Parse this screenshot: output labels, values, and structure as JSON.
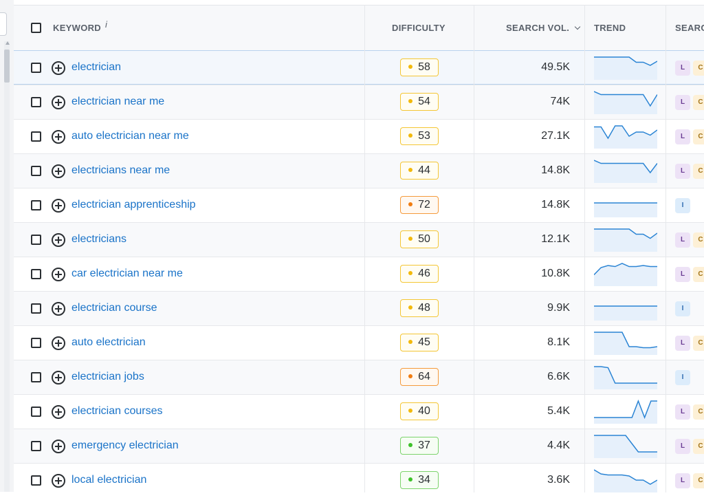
{
  "headers": {
    "keyword": "KEYWORD",
    "keyword_info": "i",
    "difficulty": "DIFFICULTY",
    "search_volume": "SEARCH VOL.",
    "trend": "TREND",
    "intent": "SEARC"
  },
  "colors": {
    "link": "#1a73c8",
    "kd_yellow": "#f2b90c",
    "kd_orange": "#f07d12",
    "kd_green": "#3ec12a",
    "trend_line": "#2a84d4",
    "trend_fill": "#e6f0fb"
  },
  "rows": [
    {
      "keyword": "electrician",
      "kd": "58",
      "kd_level": "yellow",
      "volume": "49.5K",
      "intents": [
        "L",
        "C"
      ],
      "trend": [
        1,
        1,
        1,
        1,
        1,
        1,
        0.75,
        0.75,
        0.6,
        0.8
      ],
      "selected": true
    },
    {
      "keyword": "electrician near me",
      "kd": "54",
      "kd_level": "yellow",
      "volume": "74K",
      "intents": [
        "L",
        "C"
      ],
      "trend": [
        1,
        0.85,
        0.85,
        0.85,
        0.85,
        0.85,
        0.85,
        0.85,
        0.3,
        0.85
      ]
    },
    {
      "keyword": "auto electrician near me",
      "kd": "53",
      "kd_level": "yellow",
      "volume": "27.1K",
      "intents": [
        "L",
        "C"
      ],
      "trend": [
        0.95,
        0.95,
        0.4,
        1,
        1,
        0.5,
        0.7,
        0.7,
        0.55,
        0.8
      ]
    },
    {
      "keyword": "electricians near me",
      "kd": "44",
      "kd_level": "yellow",
      "volume": "14.8K",
      "intents": [
        "L",
        "C"
      ],
      "trend": [
        1,
        0.85,
        0.85,
        0.85,
        0.85,
        0.85,
        0.85,
        0.85,
        0.4,
        0.85
      ]
    },
    {
      "keyword": "electrician apprenticeship",
      "kd": "72",
      "kd_level": "orange",
      "volume": "14.8K",
      "intents": [
        "I"
      ],
      "trend": [
        0.6,
        0.6,
        0.6,
        0.6,
        0.6,
        0.6,
        0.6,
        0.6,
        0.6,
        0.6
      ]
    },
    {
      "keyword": "electricians",
      "kd": "50",
      "kd_level": "yellow",
      "volume": "12.1K",
      "intents": [
        "L",
        "C"
      ],
      "trend": [
        1,
        1,
        1,
        1,
        1,
        1,
        0.75,
        0.75,
        0.55,
        0.8
      ]
    },
    {
      "keyword": "car electrician near me",
      "kd": "46",
      "kd_level": "yellow",
      "volume": "10.8K",
      "intents": [
        "L",
        "C"
      ],
      "trend": [
        0.45,
        0.8,
        0.9,
        0.85,
        1,
        0.85,
        0.85,
        0.9,
        0.85,
        0.85
      ]
    },
    {
      "keyword": "electrician course",
      "kd": "48",
      "kd_level": "yellow",
      "volume": "9.9K",
      "intents": [
        "I"
      ],
      "trend": [
        0.6,
        0.6,
        0.6,
        0.6,
        0.6,
        0.6,
        0.6,
        0.6,
        0.6,
        0.6
      ]
    },
    {
      "keyword": "auto electrician",
      "kd": "45",
      "kd_level": "yellow",
      "volume": "8.1K",
      "intents": [
        "L",
        "C"
      ],
      "trend": [
        1,
        1,
        1,
        1,
        1,
        0.3,
        0.3,
        0.25,
        0.25,
        0.3
      ]
    },
    {
      "keyword": "electrician jobs",
      "kd": "64",
      "kd_level": "orange",
      "volume": "6.6K",
      "intents": [
        "I"
      ],
      "trend": [
        1,
        1,
        0.95,
        0.2,
        0.2,
        0.2,
        0.2,
        0.2,
        0.2,
        0.2
      ]
    },
    {
      "keyword": "electrician courses",
      "kd": "40",
      "kd_level": "yellow",
      "volume": "5.4K",
      "intents": [
        "L",
        "C"
      ],
      "trend": [
        0.2,
        0.2,
        0.2,
        0.2,
        0.2,
        0.2,
        0.2,
        1,
        0.2,
        1,
        1
      ]
    },
    {
      "keyword": "emergency electrician",
      "kd": "37",
      "kd_level": "green",
      "volume": "4.4K",
      "intents": [
        "L",
        "C"
      ],
      "trend": [
        1,
        1,
        1,
        1,
        1,
        1,
        0.6,
        0.2,
        0.2,
        0.2,
        0.2
      ]
    },
    {
      "keyword": "local electrician",
      "kd": "34",
      "kd_level": "green",
      "volume": "3.6K",
      "intents": [
        "L",
        "C"
      ],
      "trend": [
        1,
        0.8,
        0.75,
        0.75,
        0.75,
        0.7,
        0.5,
        0.5,
        0.3,
        0.5
      ]
    }
  ]
}
